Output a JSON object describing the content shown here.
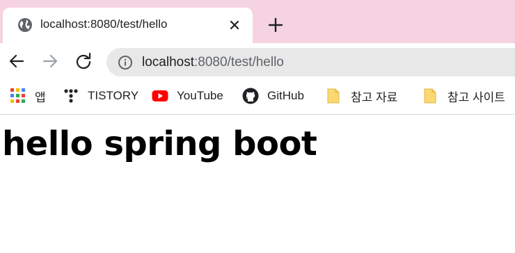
{
  "tab": {
    "title": "localhost:8080/test/hello",
    "favicon": "globe-icon"
  },
  "toolbar": {
    "url_host": "localhost",
    "url_path": ":8080/test/hello"
  },
  "bookmarks": [
    {
      "label": "앱",
      "icon": "apps-grid-icon"
    },
    {
      "label": "TISTORY",
      "icon": "tistory-icon"
    },
    {
      "label": "YouTube",
      "icon": "youtube-icon"
    },
    {
      "label": "GitHub",
      "icon": "github-icon"
    },
    {
      "label": "참고 자료",
      "icon": "folder-icon"
    },
    {
      "label": "참고 사이트",
      "icon": "folder-icon"
    }
  ],
  "page": {
    "heading": "hello spring boot"
  },
  "colors": {
    "tabstrip": "#f6d3e1",
    "omnibox": "#e8e8e8",
    "youtube_red": "#ff0000",
    "folder_yellow": "#fbd872"
  }
}
